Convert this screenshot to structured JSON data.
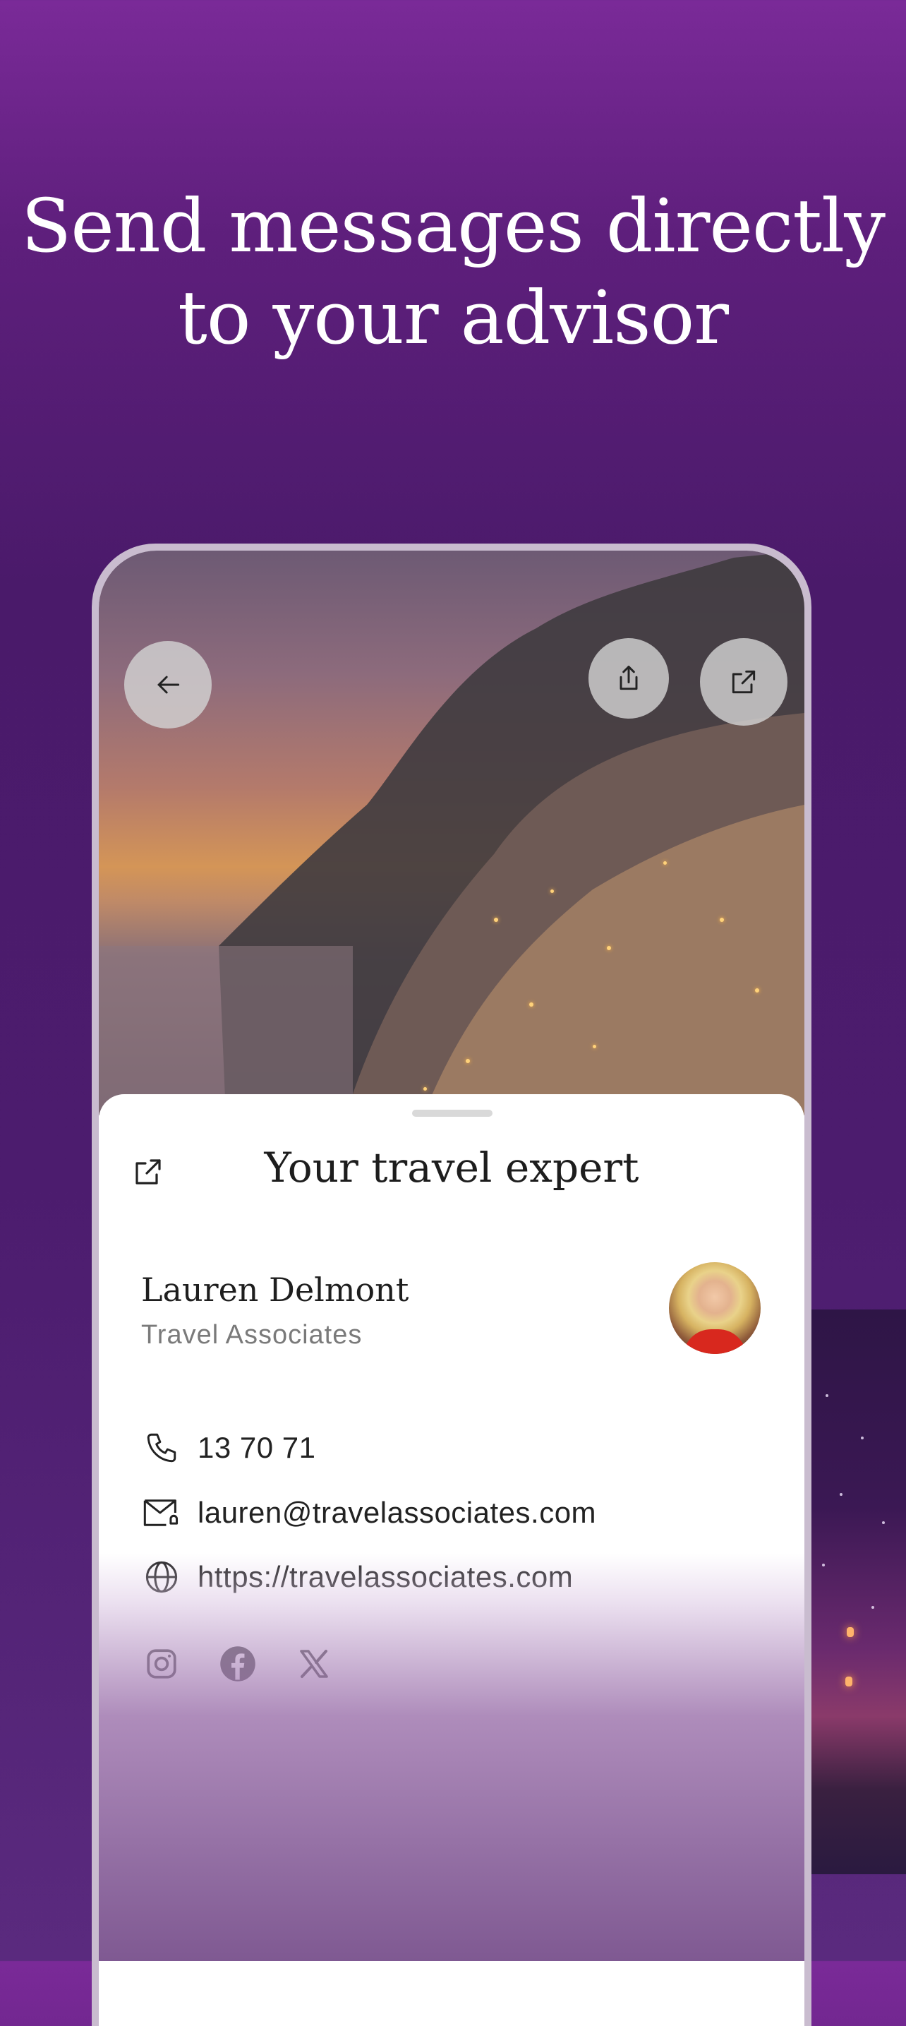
{
  "headline": {
    "line1": "Send messages directly",
    "line2": "to your advisor"
  },
  "hero_buttons": {
    "back_icon": "arrow-left-icon",
    "share_icon": "share-icon",
    "open_icon": "external-link-icon"
  },
  "sheet": {
    "title": "Your travel expert",
    "advisor_name": "Lauren Delmont",
    "company": "Travel Associates",
    "phone": "13 70 71",
    "email": "lauren@travelassociates.com",
    "website": "https://travelassociates.com"
  },
  "social": [
    "instagram-icon",
    "facebook-icon",
    "x-icon"
  ],
  "colors": {
    "background": "#4a1a6a",
    "accent": "#7a2a98",
    "sheet": "#ffffff"
  }
}
